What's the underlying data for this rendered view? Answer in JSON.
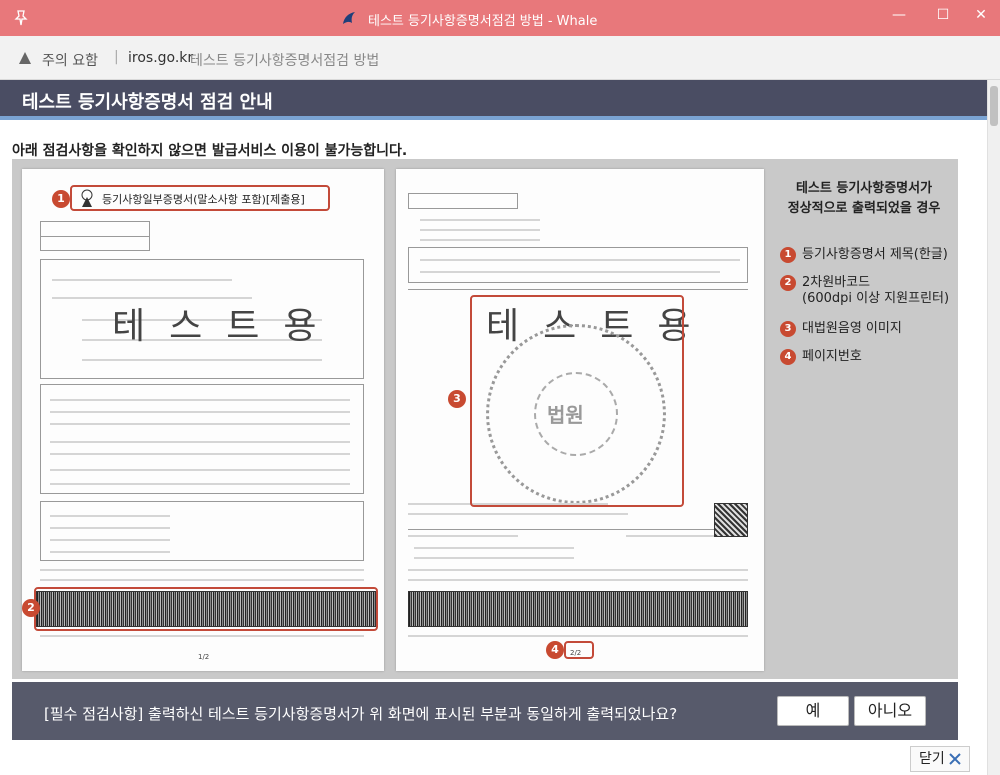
{
  "window": {
    "title": "테스트 등기사항증명서점검 방법 - Whale"
  },
  "address_bar": {
    "warning": "주의 요함",
    "separator": "|",
    "domain": "iros.go.kr",
    "page_title": "테스트 등기사항증명서점검 방법"
  },
  "header": {
    "title": "테스트 등기사항증명서 점검 안내"
  },
  "notice": "아래 점검사항을 확인하지 않으면 발급서비스 이용이 불가능합니다.",
  "doc1": {
    "title": "등기사항일부증명서(말소사항 포함)[제출용]",
    "stamp": "테스트용",
    "page_no": "1/2"
  },
  "doc2": {
    "stamp": "테스트용",
    "seal": "법원",
    "page_no": "2/2"
  },
  "legend": {
    "heading_line1": "테스트 등기사항증명서가",
    "heading_line2": "정상적으로 출력되었을 경우",
    "items": [
      {
        "num": "1",
        "label": "등기사항증명서 제목(한글)"
      },
      {
        "num": "2",
        "label_line1": "2차원바코드",
        "label_line2": "(600dpi 이상 지원프린터)"
      },
      {
        "num": "3",
        "label": "대법원음영 이미지"
      },
      {
        "num": "4",
        "label": "페이지번호"
      }
    ]
  },
  "question": {
    "text": "[필수 점검사항] 출력하신 테스트 등기사항증명서가 위 화면에 표시된 부분과 동일하게 출력되었나요?",
    "yes": "예",
    "no": "아니오"
  },
  "close_label": "닫기",
  "colors": {
    "titlebar": "#e8787b",
    "header": "#4a4d63",
    "accent_red": "#c84a31",
    "question_band": "#575a6b"
  }
}
